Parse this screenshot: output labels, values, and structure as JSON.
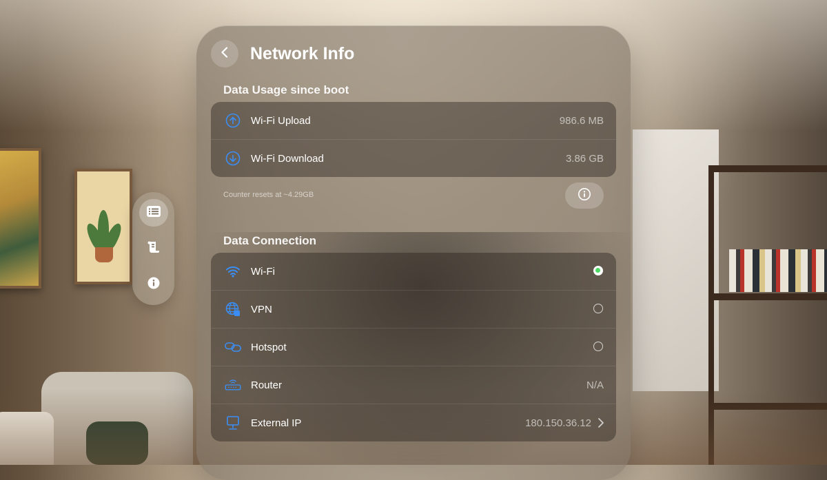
{
  "header": {
    "title": "Network Info"
  },
  "sidebar": {
    "items": [
      {
        "icon": "list-icon",
        "active": true
      },
      {
        "icon": "scroll-icon",
        "active": false
      },
      {
        "icon": "info-icon",
        "active": false
      }
    ]
  },
  "data_usage": {
    "section_title": "Data Usage since boot",
    "rows": [
      {
        "icon": "upload-arrow-icon",
        "label": "Wi-Fi Upload",
        "value": "986.6 MB"
      },
      {
        "icon": "download-arrow-icon",
        "label": "Wi-Fi Download",
        "value": "3.86 GB"
      }
    ],
    "footnote": "Counter resets at ~4.29GB"
  },
  "data_connection": {
    "section_title": "Data Connection",
    "rows": [
      {
        "icon": "wifi-icon",
        "label": "Wi-Fi",
        "selected": true
      },
      {
        "icon": "vpn-globe-icon",
        "label": "VPN",
        "selected": false
      },
      {
        "icon": "hotspot-link-icon",
        "label": "Hotspot",
        "selected": false
      },
      {
        "icon": "router-icon",
        "label": "Router",
        "value": "N/A"
      },
      {
        "icon": "desktop-icon",
        "label": "External IP",
        "value": "180.150.36.12"
      }
    ]
  },
  "colors": {
    "accent": "#3a8ef6",
    "active_green": "#4cd964"
  }
}
